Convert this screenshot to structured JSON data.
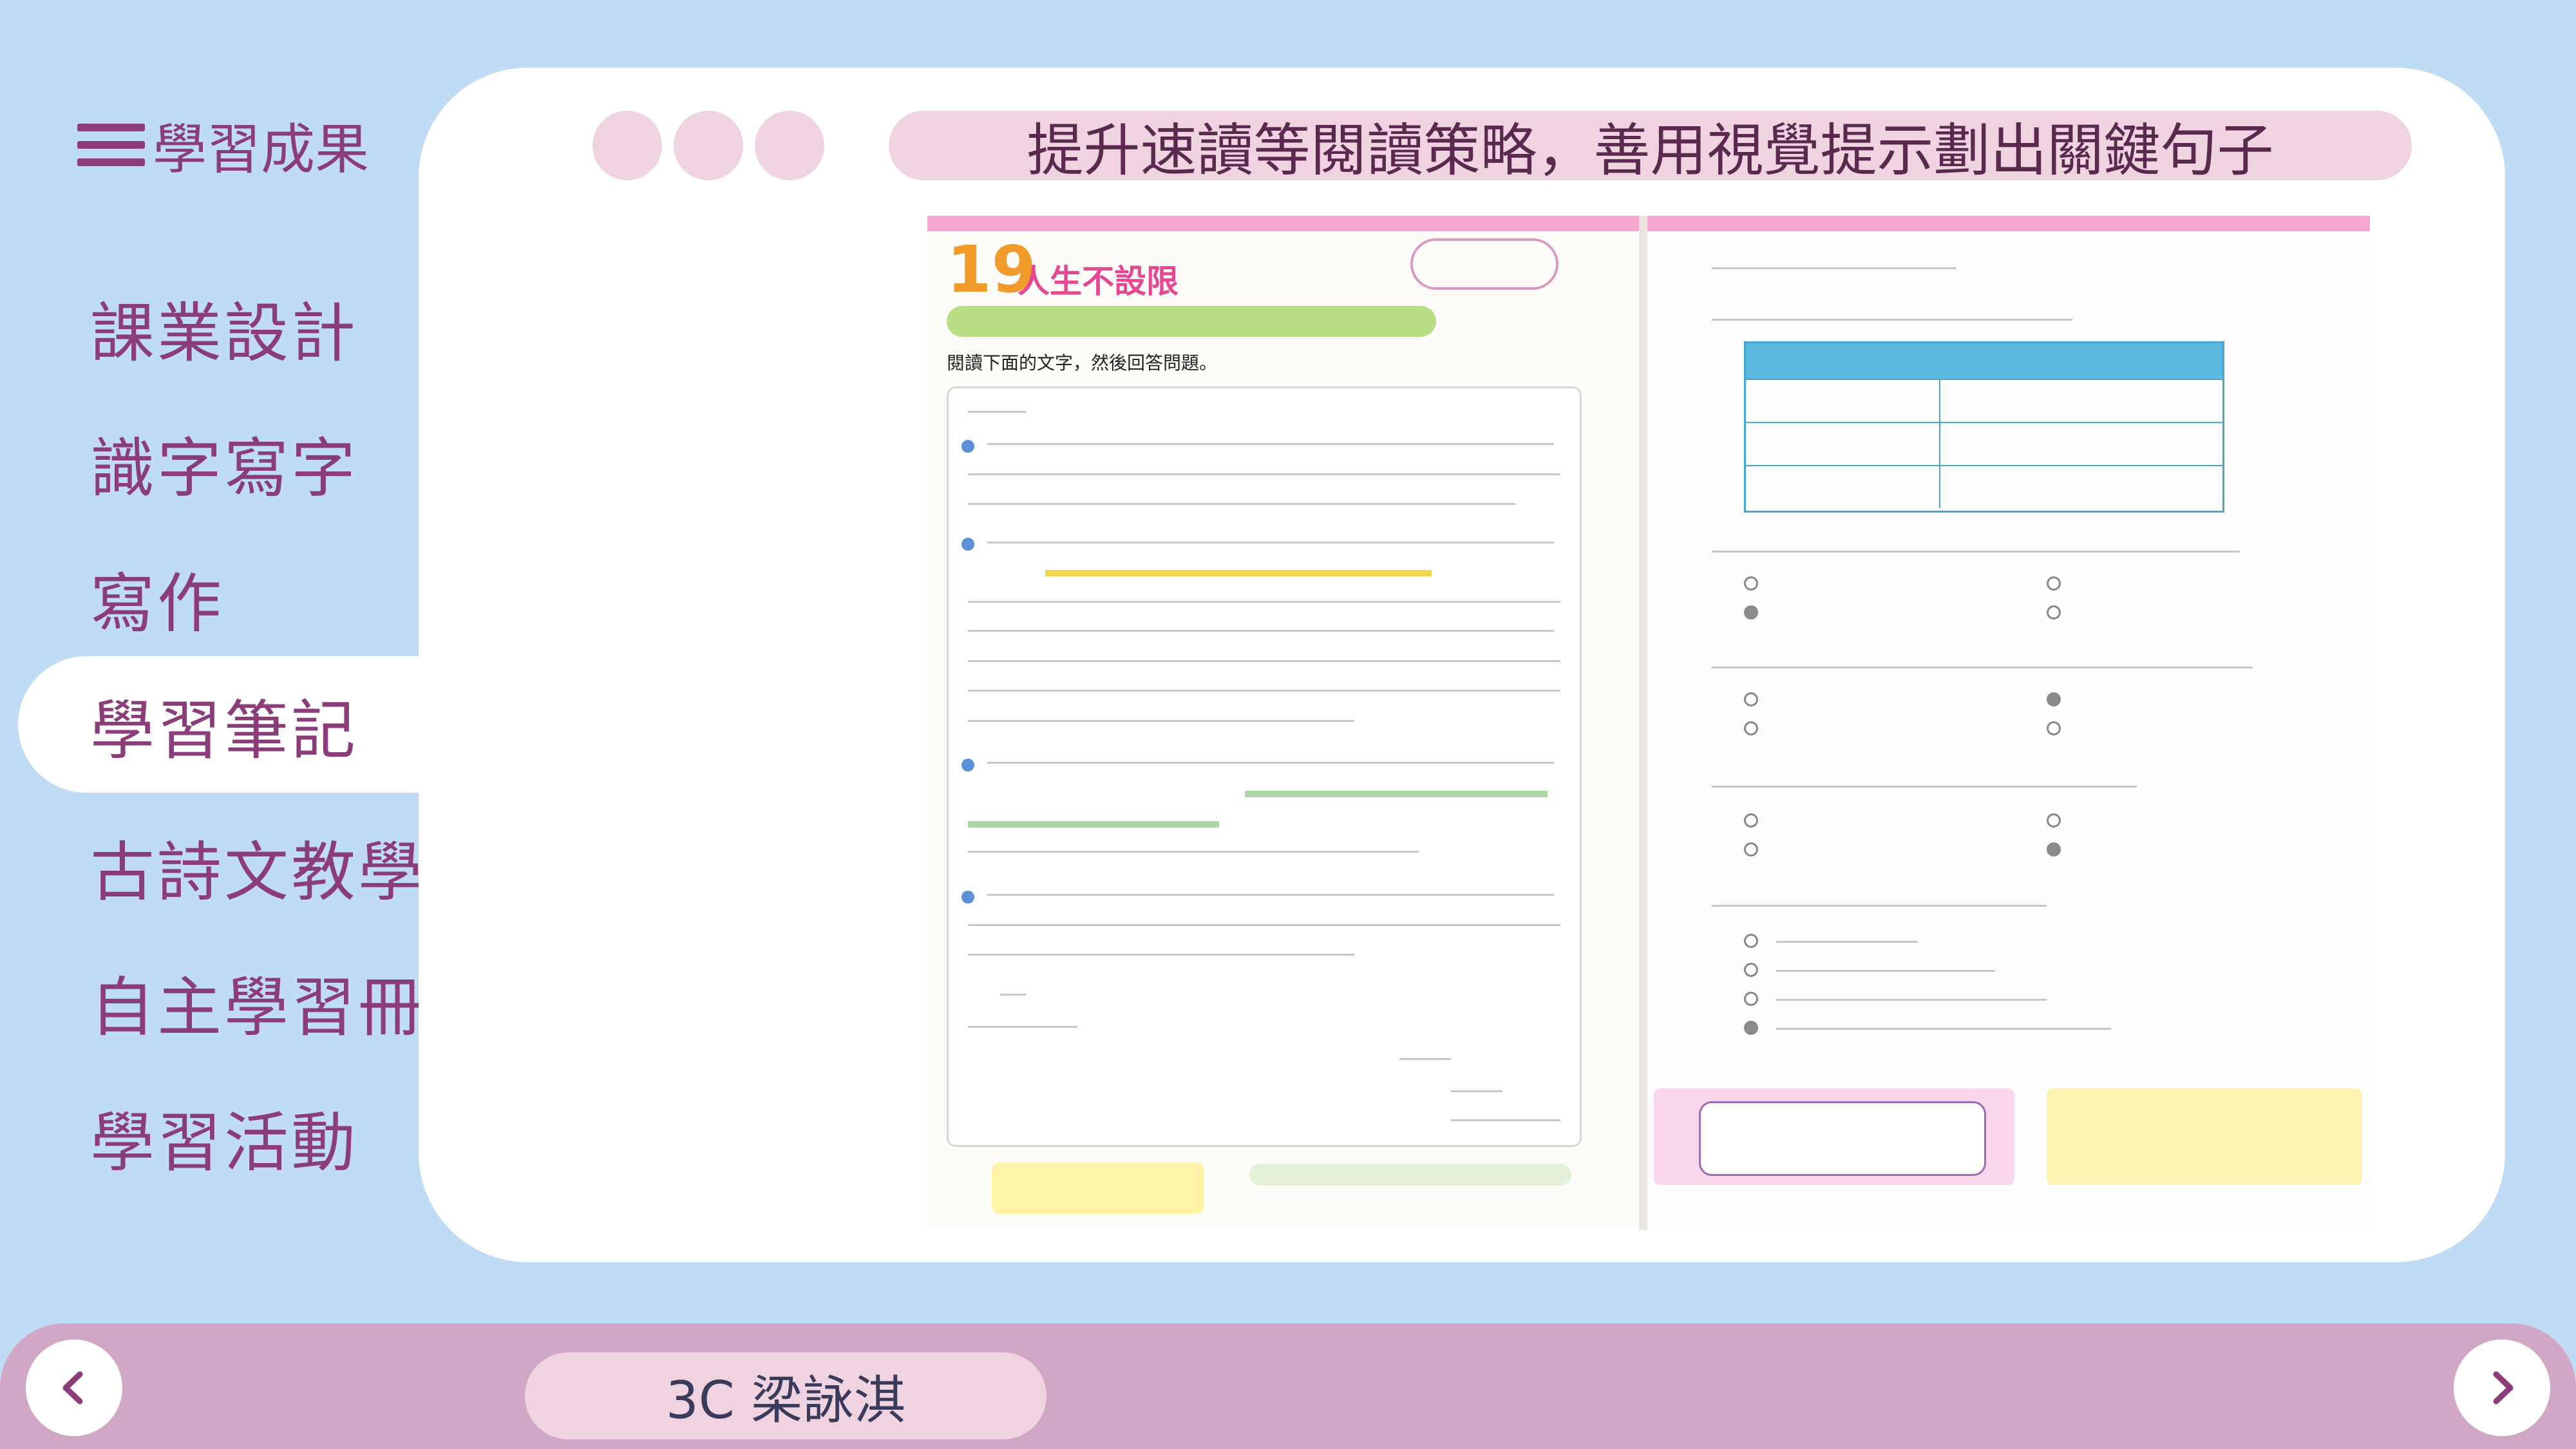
{
  "sidebar": {
    "menu_title": "學習成果",
    "items": [
      {
        "label": "課業設計"
      },
      {
        "label": "識字寫字"
      },
      {
        "label": "寫作"
      },
      {
        "label": "學習筆記",
        "active": true
      },
      {
        "label": "古詩文教學"
      },
      {
        "label": "自主學習冊"
      },
      {
        "label": "學習活動"
      }
    ]
  },
  "main": {
    "title": "提升速讀等閱讀策略，善用視覺提示劃出關鍵句子"
  },
  "document": {
    "lesson_number": "19",
    "lesson_title": "人生不設限",
    "instruction": "閱讀下面的文字，然後回答問題。"
  },
  "footer": {
    "student_name": "3C 梁詠淇"
  },
  "colors": {
    "background": "#c0dcf5",
    "accent": "#8a3d78",
    "pill": "#f0d3e1",
    "bottombar": "#d1a7c6"
  },
  "icons": {
    "menu": "hamburger-icon",
    "prev": "chevron-left-icon",
    "next": "chevron-right-icon"
  }
}
